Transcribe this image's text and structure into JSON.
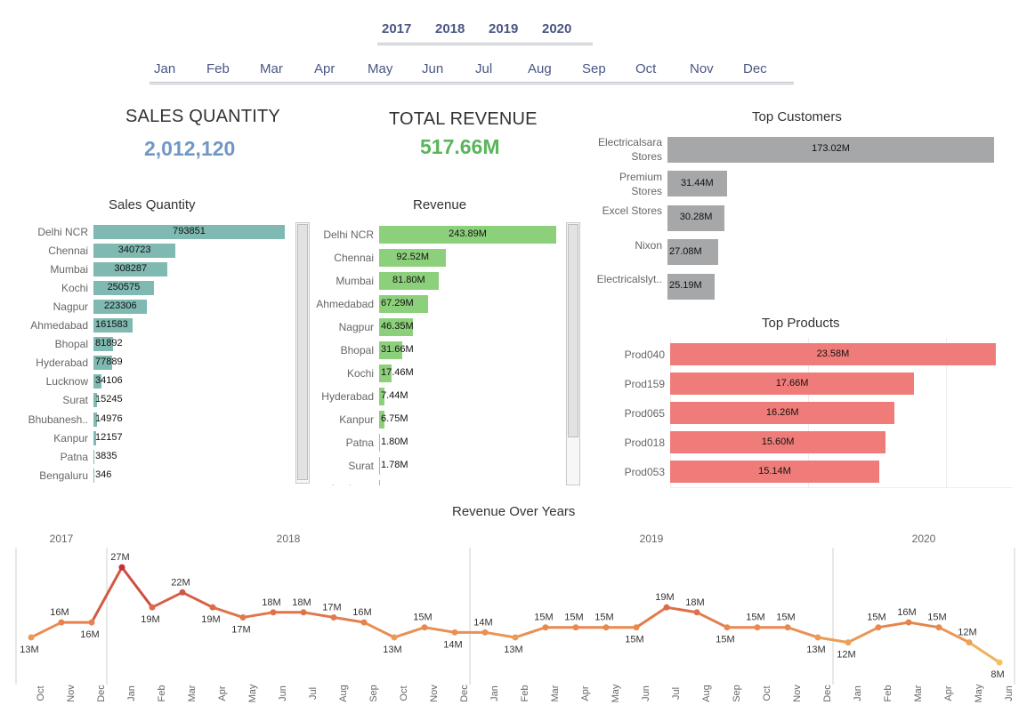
{
  "filters": {
    "years": [
      "2017",
      "2018",
      "2019",
      "2020"
    ],
    "months": [
      "Jan",
      "Feb",
      "Mar",
      "Apr",
      "May",
      "Jun",
      "Jul",
      "Aug",
      "Sep",
      "Oct",
      "Nov",
      "Dec"
    ]
  },
  "kpis": {
    "sales_quantity": {
      "title": "SALES QUANTITY",
      "value": "2,012,120",
      "color": "#6f98c4"
    },
    "total_revenue": {
      "title": "TOTAL REVENUE",
      "value": "517.66M",
      "color": "#59b55a"
    }
  },
  "colors": {
    "teal": "#7fb9b1",
    "green": "#8dd07b",
    "gray": "#a5a7a8",
    "salmon": "#f07c7a",
    "line_orange": "#e8894f",
    "line_red": "#c1303c",
    "line_yellow": "#f2c261"
  },
  "chart_data": [
    {
      "id": "sales_quantity_by_city",
      "type": "bar",
      "orientation": "horizontal",
      "title": "Sales  Quantity",
      "categories": [
        "Delhi NCR",
        "Chennai",
        "Mumbai",
        "Kochi",
        "Nagpur",
        "Ahmedabad",
        "Bhopal",
        "Hyderabad",
        "Lucknow",
        "Surat",
        "Bhubanesh..",
        "Kanpur",
        "Patna",
        "Bengaluru"
      ],
      "values": [
        793851,
        340723,
        308287,
        250575,
        223306,
        161583,
        81892,
        77889,
        34106,
        15245,
        14976,
        12157,
        3835,
        346
      ],
      "labels": [
        "793851",
        "340723",
        "308287",
        "250575",
        "223306",
        "161583",
        "81892",
        "77889",
        "34106",
        "15245",
        "14976",
        "12157",
        "3835",
        "346"
      ],
      "scrollable": true
    },
    {
      "id": "revenue_by_city",
      "type": "bar",
      "orientation": "horizontal",
      "title": "Revenue",
      "categories": [
        "Delhi NCR",
        "Chennai",
        "Mumbai",
        "Ahmedabad",
        "Nagpur",
        "Bhopal",
        "Kochi",
        "Hyderabad",
        "Kanpur",
        "Patna",
        "Surat",
        "Lucknow"
      ],
      "values": [
        243.89,
        92.52,
        81.8,
        67.29,
        46.35,
        31.66,
        17.46,
        7.44,
        6.75,
        1.8,
        1.78,
        1.0
      ],
      "labels": [
        "243.89M",
        "92.52M",
        "81.80M",
        "67.29M",
        "46.35M",
        "31.66M",
        "17.46M",
        "7.44M",
        "6.75M",
        "1.80M",
        "1.78M",
        ""
      ],
      "unit": "M",
      "scrollable": true
    },
    {
      "id": "top_customers",
      "type": "bar",
      "orientation": "horizontal",
      "title": "Top Customers",
      "categories": [
        [
          "Electricalsara",
          "Stores"
        ],
        [
          "Premium",
          "Stores"
        ],
        [
          "Excel Stores"
        ],
        [
          "Nixon"
        ],
        [
          "Electricalslyt.."
        ]
      ],
      "values": [
        173.02,
        31.44,
        30.28,
        27.08,
        25.19
      ],
      "labels": [
        "173.02M",
        "31.44M",
        "30.28M",
        "27.08M",
        "25.19M"
      ],
      "unit": "M"
    },
    {
      "id": "top_products",
      "type": "bar",
      "orientation": "horizontal",
      "title": "Top Products",
      "categories": [
        "Prod040",
        "Prod159",
        "Prod065",
        "Prod018",
        "Prod053"
      ],
      "values": [
        23.58,
        17.66,
        16.26,
        15.6,
        15.14
      ],
      "labels": [
        "23.58M",
        "17.66M",
        "16.26M",
        "15.60M",
        "15.14M"
      ],
      "unit": "M"
    },
    {
      "id": "revenue_over_years",
      "type": "line",
      "title": "Revenue Over Years",
      "years": [
        {
          "year": "2017",
          "months": [
            "Oct",
            "Nov",
            "Dec"
          ],
          "values": [
            13,
            16,
            16
          ],
          "labels": [
            "13M",
            "16M",
            "16M"
          ]
        },
        {
          "year": "2018",
          "months": [
            "Jan",
            "Feb",
            "Mar",
            "Apr",
            "May",
            "Jun",
            "Jul",
            "Aug",
            "Sep",
            "Oct",
            "Nov",
            "Dec"
          ],
          "values": [
            27,
            19,
            22,
            19,
            17,
            18,
            18,
            17,
            16,
            13,
            15,
            14
          ],
          "labels": [
            "27M",
            "19M",
            "22M",
            "19M",
            "17M",
            "18M",
            "18M",
            "17M",
            "16M",
            "13M",
            "15M",
            "14M"
          ]
        },
        {
          "year": "2019",
          "months": [
            "Jan",
            "Feb",
            "Mar",
            "Apr",
            "May",
            "Jun",
            "Jul",
            "Aug",
            "Sep",
            "Oct",
            "Nov",
            "Dec"
          ],
          "values": [
            14,
            13,
            15,
            15,
            15,
            15,
            19,
            18,
            15,
            15,
            15,
            13
          ],
          "labels": [
            "14M",
            "13M",
            "15M",
            "15M",
            "15M",
            "15M",
            "19M",
            "18M",
            "15M",
            "15M",
            "15M",
            "13M"
          ]
        },
        {
          "year": "2020",
          "months": [
            "Jan",
            "Feb",
            "Mar",
            "Apr",
            "May",
            "Jun"
          ],
          "values": [
            12,
            15,
            16,
            15,
            12,
            8
          ],
          "labels": [
            "12M",
            "15M",
            "16M",
            "15M",
            "12M",
            "8M"
          ]
        }
      ],
      "color_scale": "value-based: low = yellow, mid = orange, high = red",
      "unit": "M"
    }
  ]
}
